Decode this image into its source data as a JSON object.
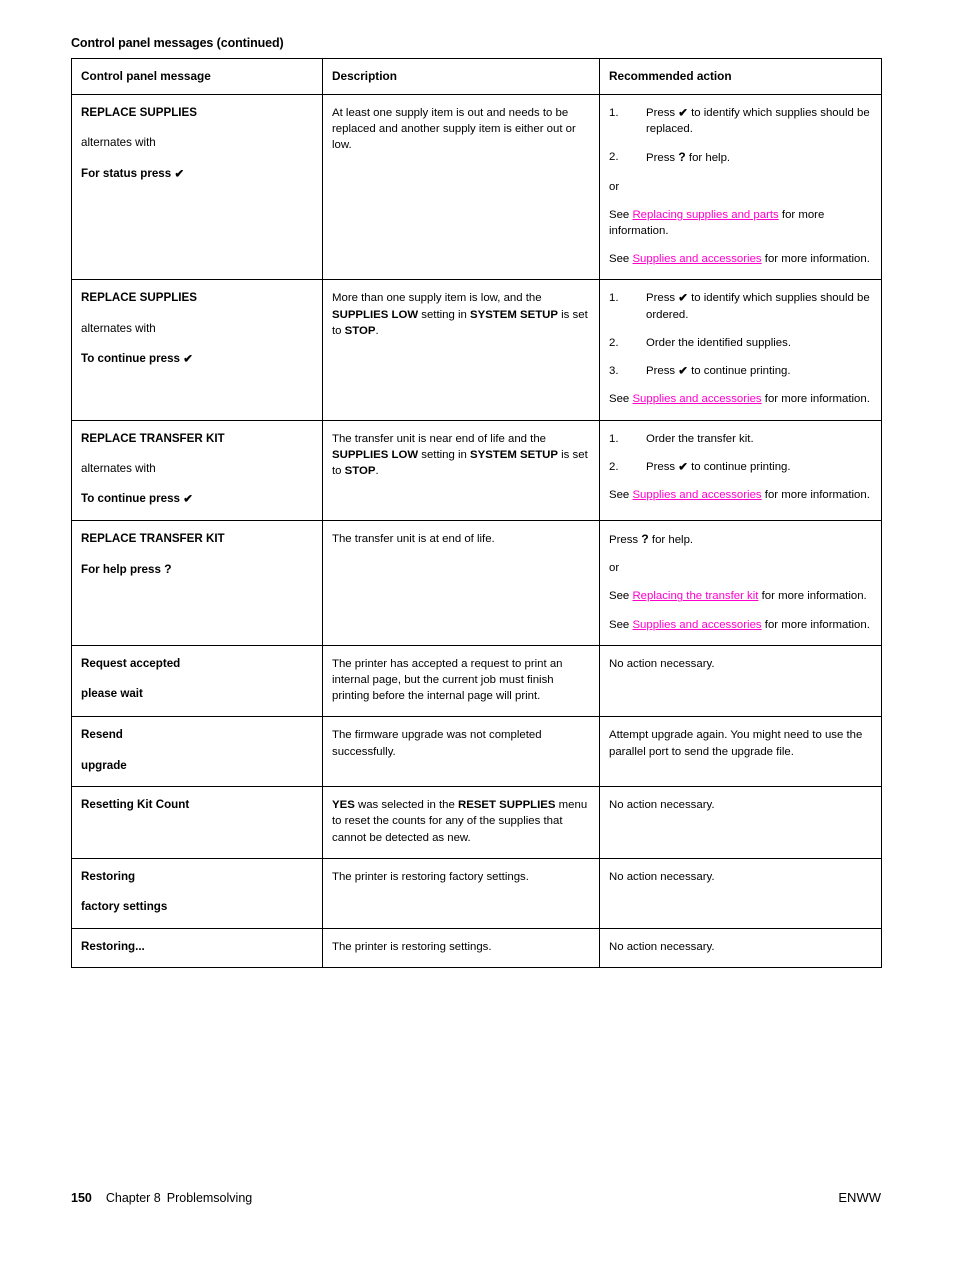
{
  "caption": "Control panel messages (continued)",
  "headers": {
    "col1": "Control panel message",
    "col2": "Description",
    "col3": "Recommended action"
  },
  "glyphs": {
    "check": "✔",
    "question": "?"
  },
  "rows": [
    {
      "message": {
        "line1": "REPLACE SUPPLIES",
        "alternates": "alternates with",
        "line2_pre": "For status press",
        "line2_glyph": "✔"
      },
      "description": {
        "text": "At least one supply item is out and needs to be replaced and another supply item is either out or low."
      },
      "action": {
        "steps": [
          {
            "pre": "Press",
            "glyph": "✔",
            "post": "to identify which supplies should be replaced."
          },
          {
            "pre": "Press",
            "glyph": "?",
            "post": "for help."
          }
        ],
        "or_label": "or",
        "see_lines": [
          {
            "see": "See",
            "link": "Replacing supplies and parts",
            "tail": "for more information."
          },
          {
            "see": "See",
            "link": "Supplies and accessories",
            "tail": "for more information."
          }
        ]
      }
    },
    {
      "message": {
        "line1": "REPLACE SUPPLIES",
        "alternates": "alternates with",
        "line2_pre": "To continue press",
        "line2_glyph": "✔"
      },
      "description": {
        "seg1": "More than one supply item is low, and the ",
        "bold1": "SUPPLIES LOW",
        "seg2": " setting in ",
        "bold2": "SYSTEM SETUP",
        "seg3": " is set to ",
        "bold3": "STOP",
        "seg4": "."
      },
      "action": {
        "steps": [
          {
            "pre": "Press",
            "glyph": "✔",
            "post": "to identify which supplies should be ordered."
          },
          {
            "pre": "",
            "glyph": "",
            "post": "Order the identified supplies."
          },
          {
            "pre": "Press",
            "glyph": "✔",
            "post": "to continue printing."
          }
        ],
        "see_lines": [
          {
            "see": "See",
            "link": "Supplies and accessories",
            "tail": "for more information."
          }
        ]
      }
    },
    {
      "message": {
        "line1": "REPLACE TRANSFER KIT",
        "alternates": "alternates with",
        "line2_pre": "To continue press",
        "line2_glyph": "✔"
      },
      "description": {
        "seg1": "The transfer unit is near end of life and the ",
        "bold1": "SUPPLIES LOW",
        "seg2": " setting in ",
        "bold2": "SYSTEM SETUP",
        "seg3": " is set to ",
        "bold3": "STOP",
        "seg4": "."
      },
      "action": {
        "steps": [
          {
            "pre": "",
            "glyph": "",
            "post": "Order the transfer kit."
          },
          {
            "pre": "Press",
            "glyph": "✔",
            "post": "to continue printing."
          }
        ],
        "see_lines": [
          {
            "see": "See",
            "link": "Supplies and accessories",
            "tail": "for more information."
          }
        ]
      }
    },
    {
      "message": {
        "line1": "REPLACE TRANSFER KIT",
        "line2_pre": "For help press",
        "line2_glyph": "?"
      },
      "description": {
        "text": "The transfer unit is at end of life."
      },
      "action": {
        "press_pre": "Press",
        "press_glyph": "?",
        "press_post": "for help.",
        "or_label": "or",
        "see_lines": [
          {
            "see": "See",
            "link": "Replacing the transfer kit",
            "tail": "for more information."
          },
          {
            "see": "See",
            "link": "Supplies and accessories",
            "tail": "for more information."
          }
        ]
      }
    },
    {
      "message": {
        "line1": "Request accepted",
        "line2": "please wait"
      },
      "description": {
        "text": "The printer has accepted a request to print an internal page, but the current job must finish printing before the internal page will print."
      },
      "action": {
        "text": "No action necessary."
      }
    },
    {
      "message": {
        "line1": "Resend",
        "line2": "upgrade"
      },
      "description": {
        "text": "The firmware upgrade was not completed successfully."
      },
      "action": {
        "text": "Attempt upgrade again. You might need to use the parallel port to send the upgrade file."
      }
    },
    {
      "message": {
        "line1": "Resetting Kit Count"
      },
      "description": {
        "bold1": "YES",
        "seg1": " was selected in the ",
        "bold2": "RESET SUPPLIES",
        "seg2": " menu to reset the counts for any of the supplies that cannot be detected as new."
      },
      "action": {
        "text": "No action necessary."
      }
    },
    {
      "message": {
        "line1": "Restoring",
        "line2": "factory settings"
      },
      "description": {
        "text": "The printer is restoring factory settings."
      },
      "action": {
        "text": "No action necessary."
      }
    },
    {
      "message": {
        "line1": "Restoring..."
      },
      "description": {
        "text": "The printer is restoring settings."
      },
      "action": {
        "text": "No action necessary."
      }
    }
  ],
  "footer": {
    "page_number": "150",
    "chapter": "Chapter 8",
    "chapter_title": "Problemsolving",
    "locale": "ENWW"
  },
  "colors": {
    "link": "#ff00cc",
    "text": "#000000",
    "border": "#000000"
  }
}
